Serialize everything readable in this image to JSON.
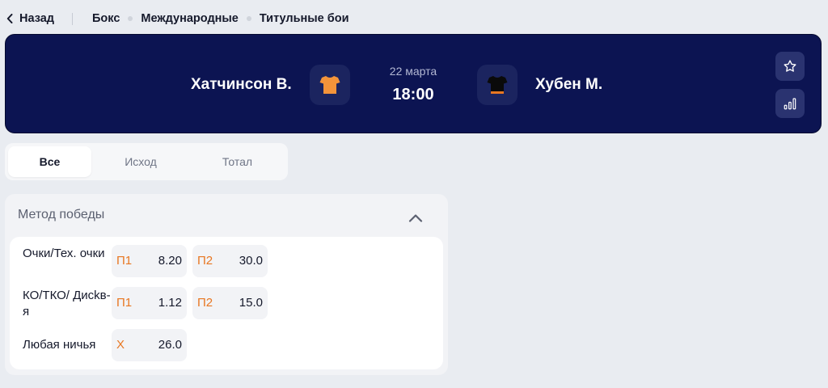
{
  "breadcrumb": {
    "back_label": "Назад",
    "items": [
      "Бокс",
      "Международные",
      "Титульные бои"
    ]
  },
  "event": {
    "home": {
      "name": "Хатчинсон В.",
      "jersey_color": "#f4943a"
    },
    "away": {
      "name": "Хубен М.",
      "jersey_color": "#0a0a0a"
    },
    "date": "22 марта",
    "time": "18:00",
    "header_bg": "#0c1452"
  },
  "tabs": [
    {
      "label": "Все",
      "active": true
    },
    {
      "label": "Исход",
      "active": false
    },
    {
      "label": "Тотал",
      "active": false
    }
  ],
  "market": {
    "title": "Метод победы",
    "rows": [
      {
        "label": "Очки/Тех. очки",
        "odds": [
          {
            "name": "П1",
            "value": "8.20"
          },
          {
            "name": "П2",
            "value": "30.0"
          }
        ]
      },
      {
        "label": "КО/ТКО/ Дисkв-я",
        "odds": [
          {
            "name": "П1",
            "value": "1.12"
          },
          {
            "name": "П2",
            "value": "15.0"
          }
        ]
      },
      {
        "label": "Любая ничья",
        "odds": [
          {
            "name": "Х",
            "value": "26.0"
          }
        ]
      }
    ]
  },
  "icons": [
    "chevron-left-icon",
    "shirt-icon",
    "star-icon",
    "stats-bars-icon",
    "chevron-up-icon"
  ],
  "accent_color": "#e87722"
}
